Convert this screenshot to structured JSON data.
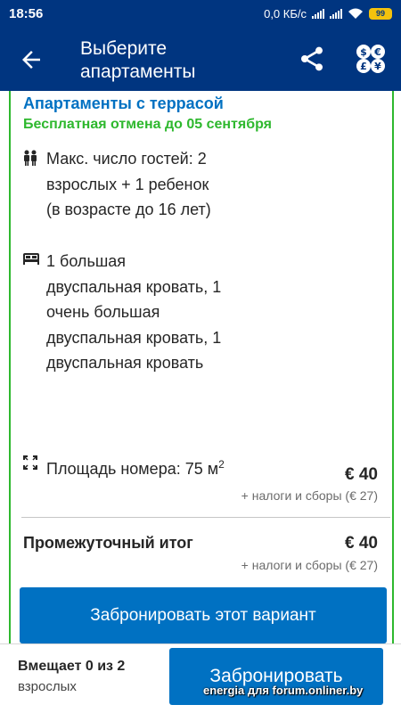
{
  "status_bar": {
    "time": "18:56",
    "network_speed": "0,0 КБ/с",
    "battery": "99",
    "icons": [
      "signal-icon",
      "signal-icon",
      "wifi-icon",
      "battery-icon"
    ]
  },
  "app_bar": {
    "title": "Выберите апартаменты",
    "icons": [
      "back-arrow-icon",
      "share-icon",
      "currency-icon"
    ]
  },
  "room": {
    "title": "Апартаменты с террасой",
    "cancellation": "Бесплатная отмена до 05 сентября",
    "features": [
      {
        "icon": "guests-icon",
        "text": "Макс. число гостей: 2 взрослых + 1 ребенок (в возрасте до 16 лет)"
      },
      {
        "icon": "bed-icon",
        "text": "1 большая двуспальная кровать, 1 очень большая двуспальная кровать, 1 двуспальная кровать"
      },
      {
        "icon": "room-size-icon",
        "text": "Площадь номера: 75 м",
        "superscript": "2"
      }
    ],
    "price": "€ 40",
    "taxes": "+ налоги и сборы (€ 27)"
  },
  "subtotal": {
    "label": "Промежуточный итог",
    "price": "€ 40",
    "taxes": "+ налоги и сборы (€ 27)"
  },
  "book_variant_label": "Забронировать этот вариант",
  "bottom_bar": {
    "fits": "Вмещает 0 из 2",
    "fits_sub": "взрослых",
    "book_label": "Забронировать"
  },
  "watermark": "energia для forum.onliner.by",
  "colors": {
    "brand_dark": "#003580",
    "brand_blue": "#0071c2",
    "green": "#2eb82e",
    "battery": "#f4c20d"
  }
}
